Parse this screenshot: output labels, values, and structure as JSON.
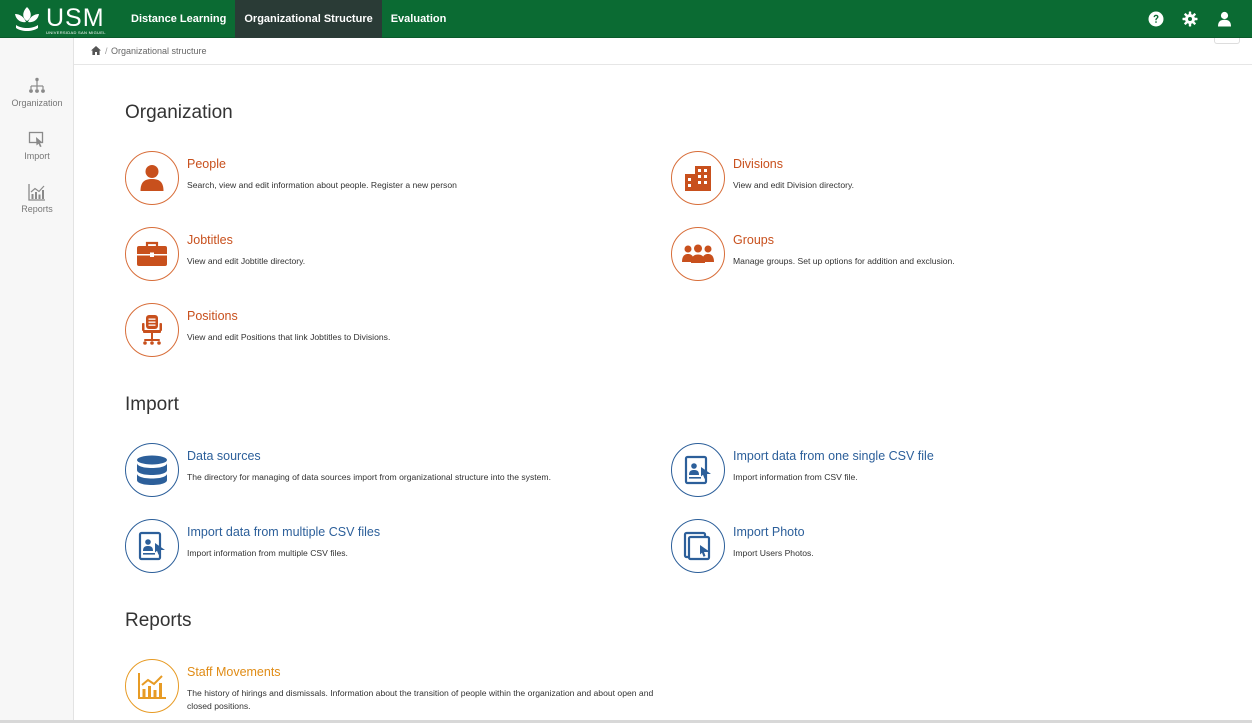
{
  "brand": {
    "name": "USM",
    "tagline": "UNIVERSIDAD SAN MIGUEL"
  },
  "colors": {
    "header": "#0b6b33",
    "active_tab": "#2a3b36",
    "orange": "#c8501d",
    "blue": "#2c5f9a",
    "gold": "#e08c16"
  },
  "nav": {
    "items": [
      {
        "label": "Distance Learning"
      },
      {
        "label": "Organizational Structure"
      },
      {
        "label": "Evaluation"
      }
    ],
    "icons": [
      "help-icon",
      "gear-icon",
      "user-icon"
    ]
  },
  "sidebar": {
    "items": [
      {
        "label": "Organization",
        "icon": "org-chart-icon"
      },
      {
        "label": "Import",
        "icon": "import-icon"
      },
      {
        "label": "Reports",
        "icon": "chart-icon"
      }
    ]
  },
  "breadcrumb": {
    "sep": "/",
    "current": "Organizational structure"
  },
  "sections": {
    "organization": {
      "title": "Organization",
      "cards": [
        {
          "title": "People",
          "desc": "Search, view and edit information about people. Register a new person",
          "icon": "person-icon"
        },
        {
          "title": "Divisions",
          "desc": "View and edit Division directory.",
          "icon": "building-icon"
        },
        {
          "title": "Jobtitles",
          "desc": "View and edit Jobtitle directory.",
          "icon": "briefcase-icon"
        },
        {
          "title": "Groups",
          "desc": "Manage groups. Set up options for addition and exclusion.",
          "icon": "group-icon"
        },
        {
          "title": "Positions",
          "desc": "View and edit Positions that link Jobtitles to Divisions.",
          "icon": "chair-icon"
        }
      ]
    },
    "import": {
      "title": "Import",
      "cards": [
        {
          "title": "Data sources",
          "desc": "The directory for managing of data sources import from organizational structure into the system.",
          "icon": "database-icon"
        },
        {
          "title": "Import data from one single CSV file",
          "desc": "Import information from CSV file.",
          "icon": "csv-file-icon"
        },
        {
          "title": "Import data from multiple CSV files",
          "desc": "Import information from multiple CSV files.",
          "icon": "csv-files-icon"
        },
        {
          "title": "Import Photo",
          "desc": "Import Users Photos.",
          "icon": "photo-import-icon"
        }
      ]
    },
    "reports": {
      "title": "Reports",
      "cards": [
        {
          "title": "Staff Movements",
          "desc": "The history of hirings and dismissals. Information about the transition of people within the organization and about open and closed positions.",
          "icon": "chart-icon"
        }
      ]
    }
  }
}
